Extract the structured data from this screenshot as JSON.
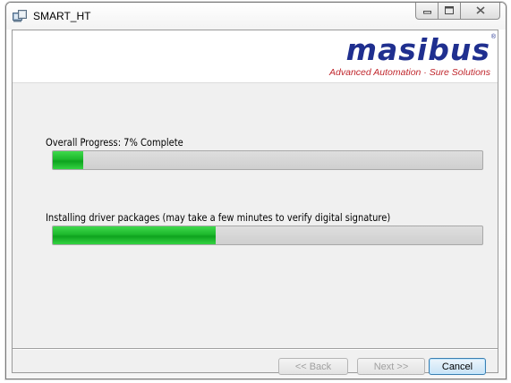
{
  "window": {
    "title": "SMART_HT",
    "icon": "installer-icon"
  },
  "caption_buttons": {
    "minimize": "minimize-icon",
    "maximize": "maximize-icon",
    "close": "close-icon"
  },
  "banner": {
    "logo": "masibus",
    "tagline": "Advanced Automation · Sure Solutions"
  },
  "overall": {
    "label": "Overall Progress: 7% Complete",
    "progress": 0.07
  },
  "task": {
    "label": "Installing driver packages (may take a few minutes to verify digital signature)",
    "progress": 0.38
  },
  "buttons": {
    "back": "<< Back",
    "next": "Next >>",
    "cancel": "Cancel"
  },
  "colors": {
    "progress_green": "#1db82c",
    "logo_blue": "#1f2f8f",
    "tagline_red": "#c0272d"
  }
}
